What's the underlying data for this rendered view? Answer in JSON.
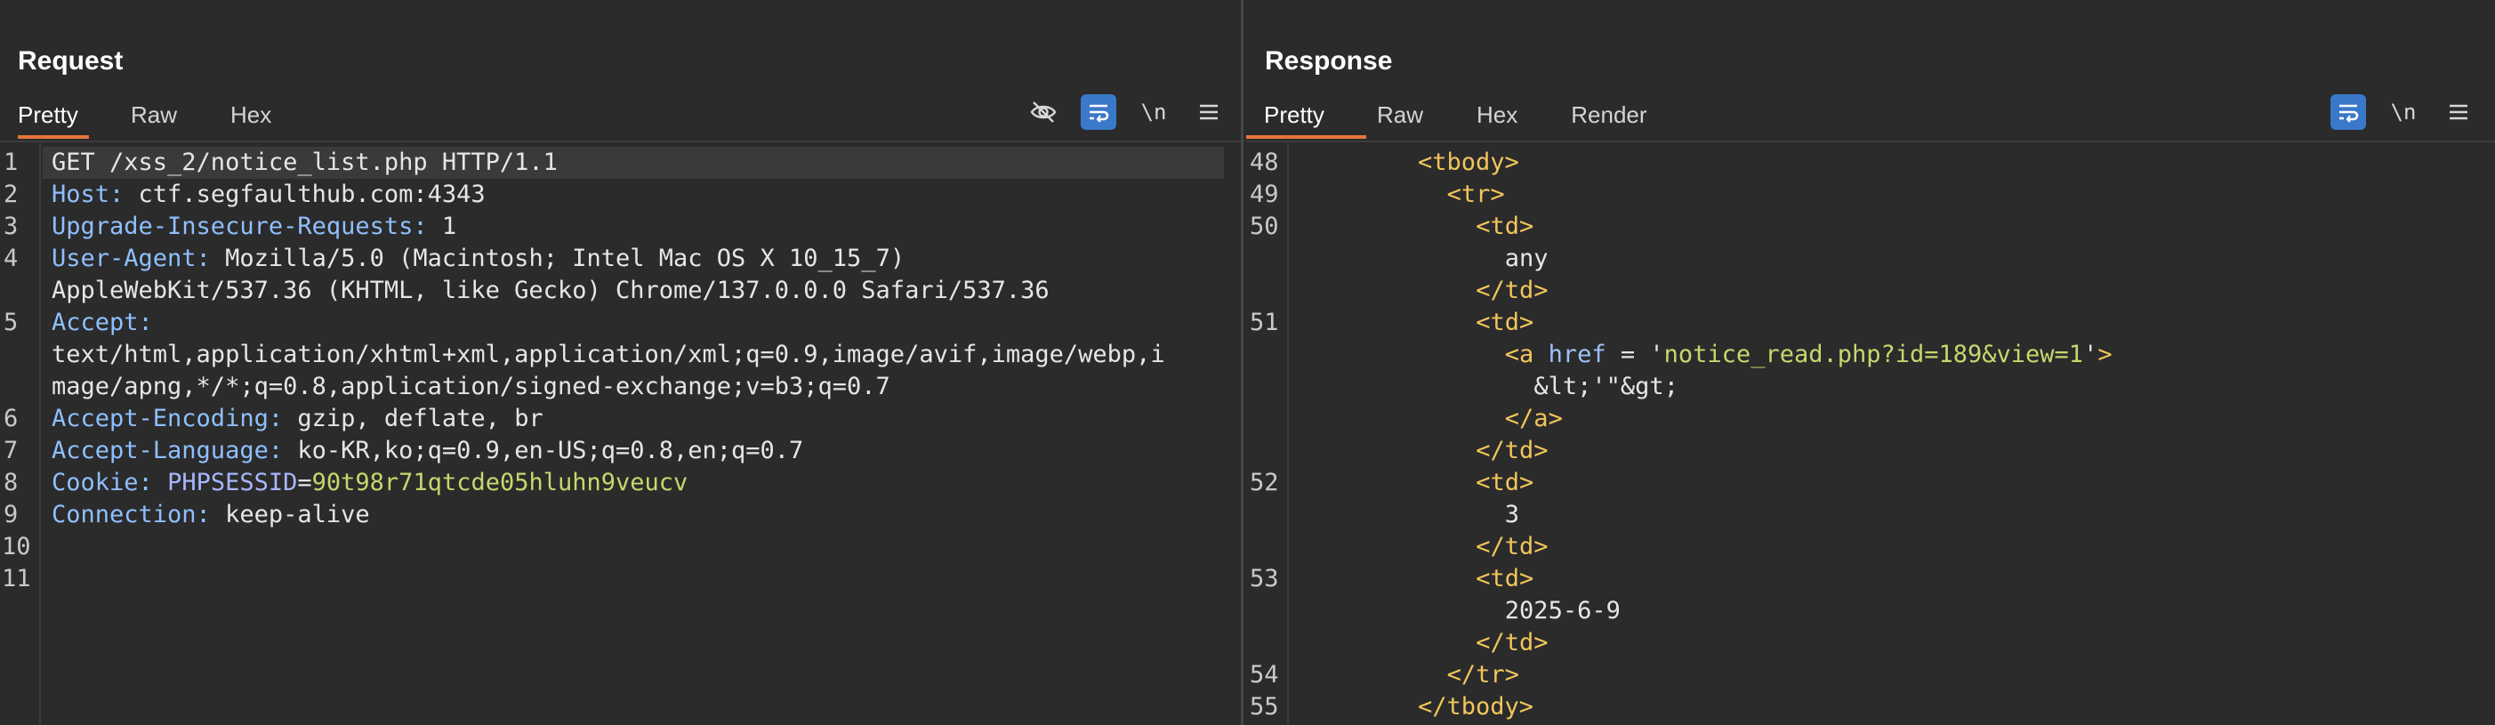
{
  "request": {
    "title": "Request",
    "tabs": [
      "Pretty",
      "Raw",
      "Hex"
    ],
    "active_tab": "Pretty",
    "line_numbers": [
      "1",
      "2",
      "3",
      "4",
      "5",
      "6",
      "7",
      "8",
      "9",
      "10",
      "11"
    ],
    "lines": [
      {
        "ln": "1",
        "key": "GET /xss_2/notice_list.php HTTP/1.1",
        "sep": "",
        "val": ""
      },
      {
        "ln": "2",
        "key": "Host:",
        "sep": " ",
        "val": "ctf.segfaulthub.com:4343"
      },
      {
        "ln": "3",
        "key": "Upgrade-Insecure-Requests:",
        "sep": " ",
        "val": "1"
      },
      {
        "ln": "4",
        "key": "User-Agent:",
        "sep": " ",
        "val": "Mozilla/5.0 (Macintosh; Intel Mac OS X 10_15_7)"
      },
      {
        "ln": "",
        "key": "",
        "sep": "",
        "val": "AppleWebKit/537.36 (KHTML, like Gecko) Chrome/137.0.0.0 Safari/537.36"
      },
      {
        "ln": "5",
        "key": "Accept:",
        "sep": "",
        "val": ""
      },
      {
        "ln": "",
        "key": "",
        "sep": "",
        "val": "text/html,application/xhtml+xml,application/xml;q=0.9,image/avif,image/webp,i"
      },
      {
        "ln": "",
        "key": "",
        "sep": "",
        "val": "mage/apng,*/*;q=0.8,application/signed-exchange;v=b3;q=0.7"
      },
      {
        "ln": "6",
        "key": "Accept-Encoding:",
        "sep": " ",
        "val": "gzip, deflate, br"
      },
      {
        "ln": "7",
        "key": "Accept-Language:",
        "sep": " ",
        "val": "ko-KR,ko;q=0.9,en-US;q=0.8,en;q=0.7"
      },
      {
        "ln": "8",
        "key": "Cookie:",
        "sep": " ",
        "val": ""
      },
      {
        "ln": "9",
        "key": "Connection:",
        "sep": " ",
        "val": "keep-alive"
      },
      {
        "ln": "10",
        "key": "",
        "sep": "",
        "val": ""
      },
      {
        "ln": "11",
        "key": "",
        "sep": "",
        "val": ""
      }
    ],
    "cookie": {
      "name": "PHPSESSID",
      "eq": "=",
      "value": "90t98r71qtcde05hluhn9veucv"
    },
    "icons": [
      "eye-off-icon",
      "wrap-icon",
      "newline-icon",
      "menu-icon"
    ]
  },
  "response": {
    "title": "Response",
    "tabs": [
      "Pretty",
      "Raw",
      "Hex",
      "Render"
    ],
    "active_tab": "Pretty",
    "lines": [
      {
        "ln": "48",
        "indent": 10,
        "parts": [
          [
            "tag",
            "<tbody>"
          ]
        ]
      },
      {
        "ln": "49",
        "indent": 12,
        "parts": [
          [
            "tag",
            "<tr>"
          ]
        ]
      },
      {
        "ln": "50",
        "indent": 14,
        "parts": [
          [
            "tag",
            "<td>"
          ]
        ]
      },
      {
        "ln": "",
        "indent": 16,
        "parts": [
          [
            "txt",
            "any"
          ]
        ]
      },
      {
        "ln": "",
        "indent": 14,
        "parts": [
          [
            "tag",
            "</td>"
          ]
        ]
      },
      {
        "ln": "51",
        "indent": 14,
        "parts": [
          [
            "tag",
            "<td>"
          ]
        ]
      },
      {
        "ln": "",
        "indent": 16,
        "parts": [
          [
            "tag",
            "<a"
          ],
          [
            "txt",
            " "
          ],
          [
            "attr",
            "href"
          ],
          [
            "txt",
            " = "
          ],
          [
            "txt",
            "'"
          ],
          [
            "str",
            "notice_read.php?id=189&view=1"
          ],
          [
            "txt",
            "'"
          ],
          [
            "tag",
            ">"
          ]
        ]
      },
      {
        "ln": "",
        "indent": 18,
        "parts": [
          [
            "txt",
            "&lt;'\"&gt;"
          ]
        ]
      },
      {
        "ln": "",
        "indent": 16,
        "parts": [
          [
            "tag",
            "</a>"
          ]
        ]
      },
      {
        "ln": "",
        "indent": 14,
        "parts": [
          [
            "tag",
            "</td>"
          ]
        ]
      },
      {
        "ln": "52",
        "indent": 14,
        "parts": [
          [
            "tag",
            "<td>"
          ]
        ]
      },
      {
        "ln": "",
        "indent": 16,
        "parts": [
          [
            "txt",
            "3"
          ]
        ]
      },
      {
        "ln": "",
        "indent": 14,
        "parts": [
          [
            "tag",
            "</td>"
          ]
        ]
      },
      {
        "ln": "53",
        "indent": 14,
        "parts": [
          [
            "tag",
            "<td>"
          ]
        ]
      },
      {
        "ln": "",
        "indent": 16,
        "parts": [
          [
            "txt",
            "2025-6-9"
          ]
        ]
      },
      {
        "ln": "",
        "indent": 14,
        "parts": [
          [
            "tag",
            "</td>"
          ]
        ]
      },
      {
        "ln": "54",
        "indent": 12,
        "parts": [
          [
            "tag",
            "</tr>"
          ]
        ]
      },
      {
        "ln": "55",
        "indent": 10,
        "parts": [
          [
            "tag",
            "</tbody>"
          ]
        ]
      }
    ],
    "icons": [
      "wrap-icon",
      "newline-icon",
      "menu-icon"
    ]
  },
  "toolbar": {
    "newline_label": "\\n"
  },
  "layout_switch": [
    "split-horizontal-icon",
    "split-vertical-icon",
    "single-pane-icon"
  ],
  "colors": {
    "accent": "#e8743b",
    "active_toggle": "#3a78c9",
    "tag": "#f2c55c",
    "string": "#c5d86d"
  }
}
